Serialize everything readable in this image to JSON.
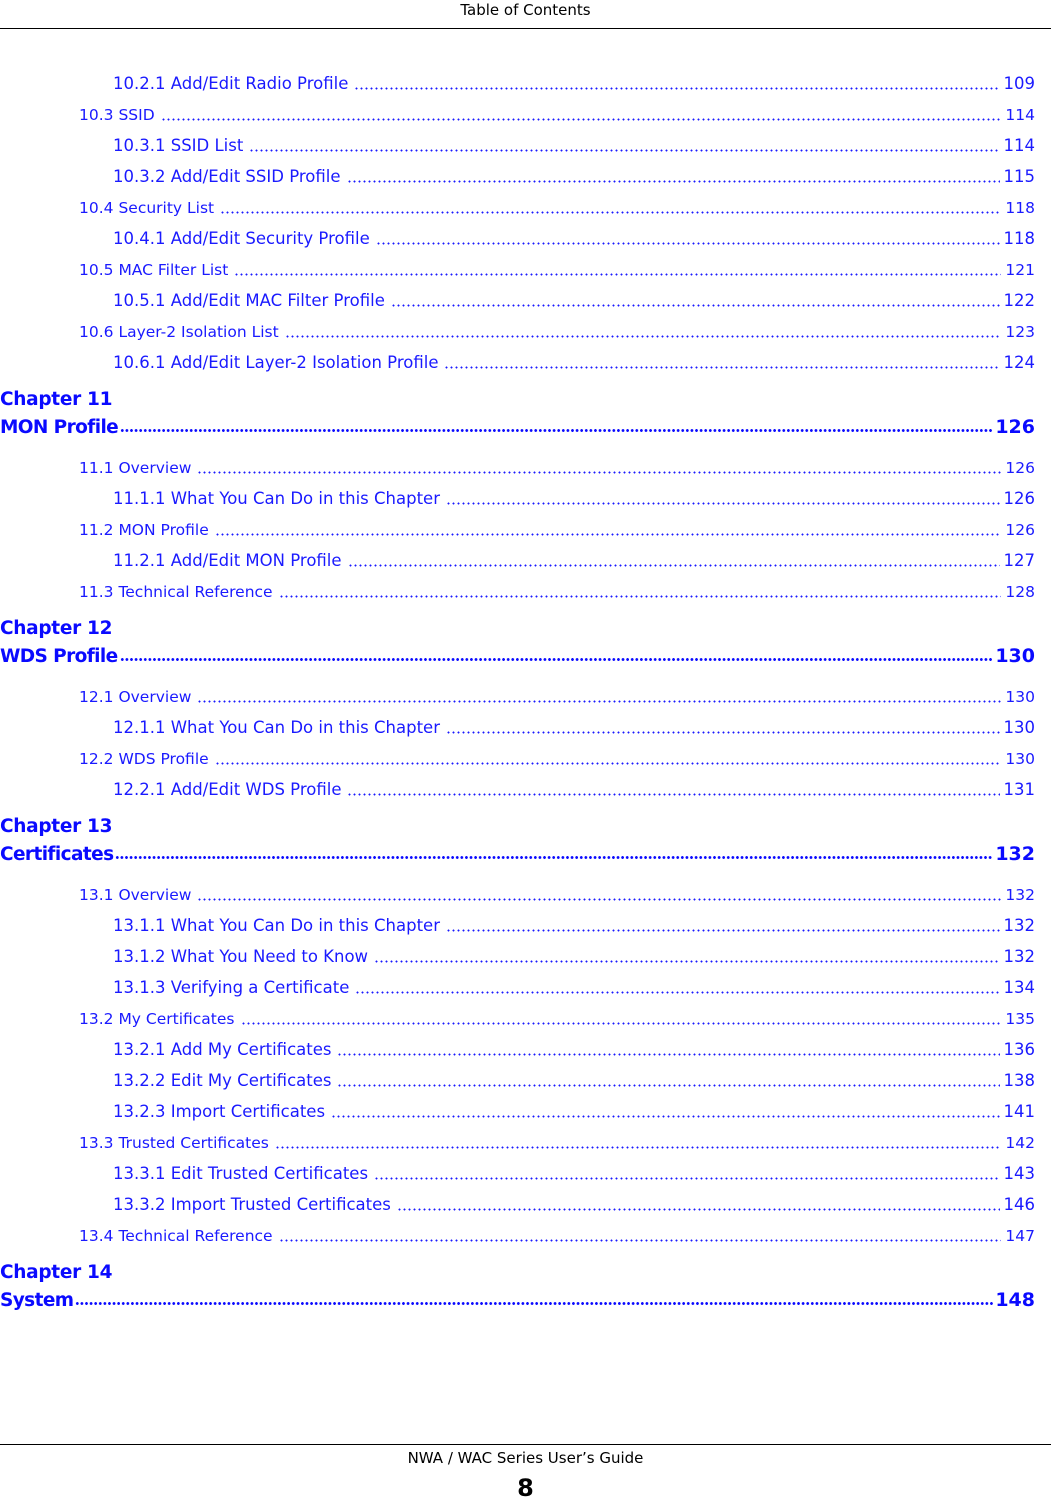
{
  "header": {
    "title": "Table of Contents"
  },
  "footer": {
    "guide": "NWA / WAC Series User’s Guide",
    "page_number": "8"
  },
  "toc": {
    "leading_entries": [
      {
        "level": 3,
        "label": "10.2.1 Add/Edit Radio Profile",
        "page": "109"
      },
      {
        "level": 2,
        "label": "10.3 SSID",
        "page": "114"
      },
      {
        "level": 3,
        "label": "10.3.1 SSID List",
        "page": "114"
      },
      {
        "level": 3,
        "label": "10.3.2 Add/Edit SSID Profile",
        "page": "115"
      },
      {
        "level": 2,
        "label": "10.4 Security List",
        "page": "118"
      },
      {
        "level": 3,
        "label": "10.4.1 Add/Edit Security Profile",
        "page": "118"
      },
      {
        "level": 2,
        "label": "10.5 MAC Filter List",
        "page": "121"
      },
      {
        "level": 3,
        "label": "10.5.1 Add/Edit MAC Filter Profile",
        "page": "122"
      },
      {
        "level": 2,
        "label": "10.6 Layer-2 Isolation List",
        "page": "123"
      },
      {
        "level": 3,
        "label": "10.6.1 Add/Edit Layer-2 Isolation Profile",
        "page": "124"
      }
    ],
    "chapters": [
      {
        "chapter_label": "Chapter 11",
        "title": "MON Profile",
        "page": "126",
        "entries": [
          {
            "level": 2,
            "label": "11.1 Overview",
            "page": "126"
          },
          {
            "level": 3,
            "label": "11.1.1 What You Can Do in this Chapter",
            "page": "126"
          },
          {
            "level": 2,
            "label": "11.2 MON Profile",
            "page": "126"
          },
          {
            "level": 3,
            "label": "11.2.1 Add/Edit MON Profile",
            "page": "127"
          },
          {
            "level": 2,
            "label": "11.3 Technical Reference",
            "page": "128"
          }
        ]
      },
      {
        "chapter_label": "Chapter 12",
        "title": "WDS Profile",
        "page": "130",
        "entries": [
          {
            "level": 2,
            "label": "12.1 Overview",
            "page": "130"
          },
          {
            "level": 3,
            "label": "12.1.1 What You Can Do in this Chapter",
            "page": "130"
          },
          {
            "level": 2,
            "label": "12.2 WDS Profile",
            "page": "130"
          },
          {
            "level": 3,
            "label": "12.2.1 Add/Edit WDS Profile",
            "page": "131"
          }
        ]
      },
      {
        "chapter_label": "Chapter 13",
        "title": "Certificates",
        "page": "132",
        "entries": [
          {
            "level": 2,
            "label": "13.1 Overview",
            "page": "132"
          },
          {
            "level": 3,
            "label": "13.1.1 What You Can Do in this Chapter",
            "page": "132"
          },
          {
            "level": 3,
            "label": "13.1.2 What You Need to Know",
            "page": "132"
          },
          {
            "level": 3,
            "label": "13.1.3 Verifying a Certificate",
            "page": "134"
          },
          {
            "level": 2,
            "label": "13.2 My Certificates",
            "page": "135"
          },
          {
            "level": 3,
            "label": "13.2.1 Add My Certificates",
            "page": "136"
          },
          {
            "level": 3,
            "label": "13.2.2 Edit My Certificates",
            "page": "138"
          },
          {
            "level": 3,
            "label": "13.2.3 Import Certificates",
            "page": "141"
          },
          {
            "level": 2,
            "label": "13.3 Trusted Certificates",
            "page": "142"
          },
          {
            "level": 3,
            "label": "13.3.1 Edit Trusted Certificates",
            "page": "143"
          },
          {
            "level": 3,
            "label": "13.3.2 Import Trusted Certificates",
            "page": "146"
          },
          {
            "level": 2,
            "label": "13.4 Technical Reference",
            "page": "147"
          }
        ]
      },
      {
        "chapter_label": "Chapter 14",
        "title": "System",
        "page": "148",
        "entries": []
      }
    ]
  },
  "colors": {
    "link": "#1a1aff",
    "text": "#000000"
  }
}
